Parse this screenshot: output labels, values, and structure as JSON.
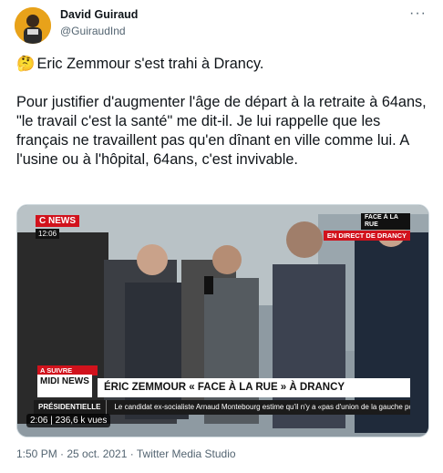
{
  "author": {
    "name": "David Guiraud",
    "handle": "@GuiraudInd"
  },
  "tweet": {
    "emoji": "🤔",
    "paragraph1": "Eric Zemmour s'est trahi à Drancy.",
    "paragraph2": "Pour justifier d'augmenter l'âge de départ à la retraite à 64ans, \"le travail c'est la santé\" me dit-il. Je lui rappelle que les français ne travaillent pas qu'en dînant en ville comme lui. A l'usine ou à l'hôpital, 64ans, c'est invivable."
  },
  "more_icon": "···",
  "video": {
    "channel_logo": "C NEWS",
    "clock": "12:06",
    "live_title": "FACE À LA RUE",
    "live_sub": "EN DIRECT DE DRANCY",
    "next_label": "A SUIVRE",
    "next_show": "MIDI NEWS",
    "headline": "ÉRIC ZEMMOUR « FACE À LA RUE » À DRANCY",
    "ticker_label": "PRÉSIDENTIELLE",
    "ticker_text": "Le candidat ex-socialiste Arnaud Montebourg estime qu'il n'y a «pas d'union de la gauche possible» au vu des querelles qui la traversent.",
    "duration": "2:06",
    "views": "236,6 k vues"
  },
  "footer": {
    "meta": "1:50 PM · 25 oct. 2021 · Twitter Media Studio"
  },
  "colors": {
    "text": "#0f1419",
    "muted": "#536471",
    "cnews_red": "#d1121c"
  }
}
